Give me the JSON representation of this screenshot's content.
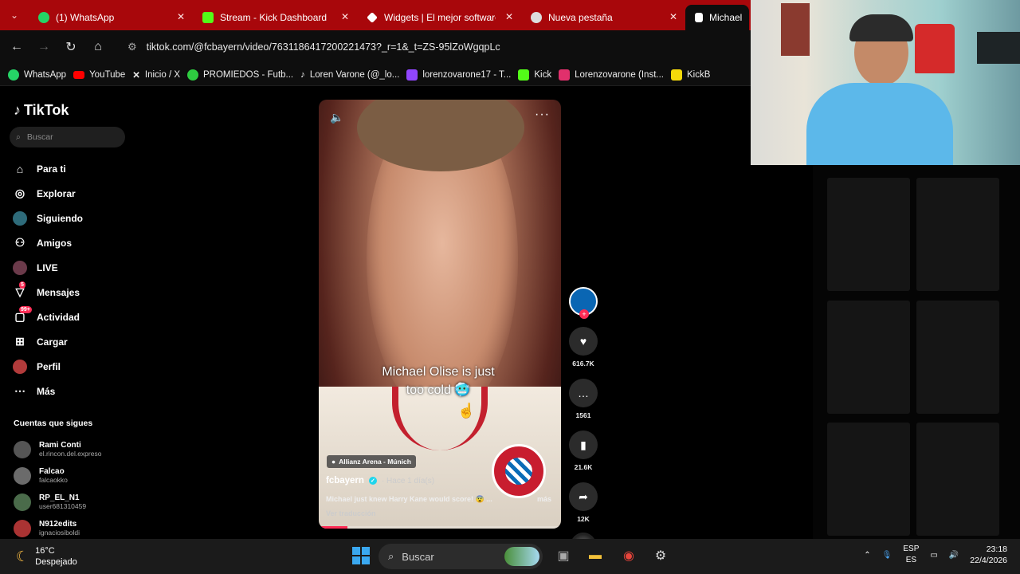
{
  "tabs": [
    {
      "label": "(1) WhatsApp",
      "icon": "whatsapp-icon",
      "color": "#25d366"
    },
    {
      "label": "Stream - Kick Dashboard",
      "icon": "kick-icon",
      "color": "#53fc18"
    },
    {
      "label": "Widgets | El mejor software",
      "icon": "widgets-icon",
      "color": "#ffffff"
    },
    {
      "label": "Nueva pestaña",
      "icon": "chrome-icon",
      "color": "#dddddd"
    },
    {
      "label": "Michael",
      "icon": "tiktok-icon",
      "color": "#ffffff"
    }
  ],
  "toolbar": {
    "url": "tiktok.com/@fcbayern/video/7631186417200221473?_r=1&_t=ZS-95lZoWgqpLc"
  },
  "bookmarks": [
    {
      "label": "WhatsApp",
      "color": "#25d366"
    },
    {
      "label": "YouTube",
      "color": "#ff0000"
    },
    {
      "label": "Inicio / X",
      "color": "#ffffff"
    },
    {
      "label": "PROMIEDOS - Futb...",
      "color": "#2ecc40"
    },
    {
      "label": "Loren Varone (@_lo...",
      "color": "#ffffff"
    },
    {
      "label": "lorenzovarone17 - T...",
      "color": "#9146ff"
    },
    {
      "label": "Kick",
      "color": "#53fc18"
    },
    {
      "label": "Lorenzovarone (Inst...",
      "color": "#e1306c"
    },
    {
      "label": "KickB",
      "color": "#f5d90a"
    }
  ],
  "sidebar": {
    "brand": "TikTok",
    "search_placeholder": "Buscar",
    "items": [
      {
        "label": "Para ti",
        "icon": "home-icon"
      },
      {
        "label": "Explorar",
        "icon": "compass-icon"
      },
      {
        "label": "Siguiendo",
        "icon": "following-icon"
      },
      {
        "label": "Amigos",
        "icon": "friends-icon"
      },
      {
        "label": "LIVE",
        "icon": "live-icon"
      },
      {
        "label": "Mensajes",
        "icon": "messages-icon",
        "badge": "5"
      },
      {
        "label": "Actividad",
        "icon": "activity-icon",
        "badge": "99+"
      },
      {
        "label": "Cargar",
        "icon": "upload-icon"
      },
      {
        "label": "Perfil",
        "icon": "profile-icon"
      },
      {
        "label": "Más",
        "icon": "more-icon"
      }
    ],
    "following_title": "Cuentas que sigues",
    "following": [
      {
        "name": "Rami Conti",
        "user": "el.rincon.del.expreso"
      },
      {
        "name": "Falcao",
        "user": "falcaokko"
      },
      {
        "name": "RP_EL_N1",
        "user": "user681310459"
      },
      {
        "name": "N912edits",
        "user": "ignaciosiboldi"
      }
    ]
  },
  "video": {
    "caption": "Michael Olise is just too cold 🥶",
    "location": "Allianz Arena - Múnich",
    "account": "fcbayern",
    "time_ago": "· Hace 1 día(s)",
    "description": "Michael just knew Harry Kane would score! 😨 ...",
    "more": "más",
    "translate": "Ver traducción",
    "progress": 0.12
  },
  "actions": {
    "likes": "616.7K",
    "comments": "1561",
    "saves": "21.6K",
    "shares": "12K"
  },
  "taskbar": {
    "temp": "16°C",
    "weather": "Despejado",
    "search": "Buscar",
    "lang": "ESP",
    "lang2": "ES",
    "time": "23:18",
    "date": "22/4/2026"
  }
}
